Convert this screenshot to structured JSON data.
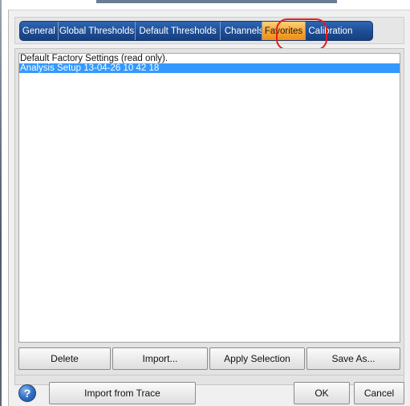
{
  "tabs": [
    {
      "label": "General",
      "active": false
    },
    {
      "label": "Global Thresholds",
      "active": false
    },
    {
      "label": "Default Thresholds",
      "active": false
    },
    {
      "label": "Channels",
      "active": false
    },
    {
      "label": "Favorites",
      "active": true
    },
    {
      "label": "Calibration",
      "active": false
    }
  ],
  "favorites": {
    "items": [
      {
        "label": "Default Factory Settings (read only).",
        "selected": false
      },
      {
        "label": "Analysis Setup 13-04-26 10 42 18",
        "selected": true
      }
    ],
    "buttons": {
      "delete": "Delete",
      "import": "Import...",
      "apply": "Apply Selection",
      "save_as": "Save As..."
    }
  },
  "footer": {
    "help_icon": "?",
    "import_from_trace": "Import from Trace",
    "ok": "OK",
    "cancel": "Cancel"
  },
  "colors": {
    "tab_blue": "#1e4f97",
    "tab_active_orange": "#f7a52f",
    "selection_blue": "#3399ff",
    "annotation_red": "#e01e1e"
  }
}
